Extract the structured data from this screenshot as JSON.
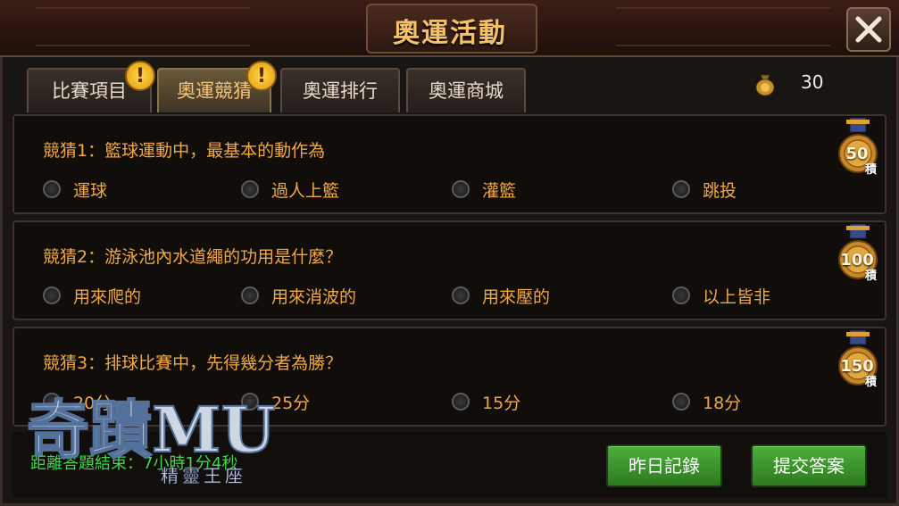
{
  "window": {
    "title": "奧運活動"
  },
  "tabs": [
    {
      "label": "比賽項目",
      "alert": "!"
    },
    {
      "label": "奧運競猜",
      "alert": "!"
    },
    {
      "label": "奧運排行"
    },
    {
      "label": "奧運商城"
    }
  ],
  "currency": {
    "icon": "point-bag-icon",
    "amount": "30"
  },
  "questions": [
    {
      "text": "競猜1：籃球運動中，最基本的動作為",
      "options": [
        "運球",
        "過人上籃",
        "灌籃",
        "跳投"
      ],
      "reward": "50",
      "reward_unit": "積"
    },
    {
      "text": "競猜2：游泳池內水道繩的功用是什麼？",
      "options": [
        "用來爬的",
        "用來消波的",
        "用來壓的",
        "以上皆非"
      ],
      "reward": "100",
      "reward_unit": "積"
    },
    {
      "text": "競猜3：排球比賽中，先得幾分者為勝？",
      "options": [
        "20分",
        "25分",
        "15分",
        "18分"
      ],
      "reward": "150",
      "reward_unit": "積"
    }
  ],
  "footer": {
    "countdown": "距離答題結束：7小時1分4秒",
    "history_button": "昨日記錄",
    "submit_button": "提交答案"
  },
  "logo": {
    "title": "奇蹟MU",
    "subtitle": "精靈王座"
  },
  "colors": {
    "accent": "#f0a845",
    "title": "#f4c06a",
    "button": "#3e9a2e",
    "timer": "#3ed84a"
  }
}
